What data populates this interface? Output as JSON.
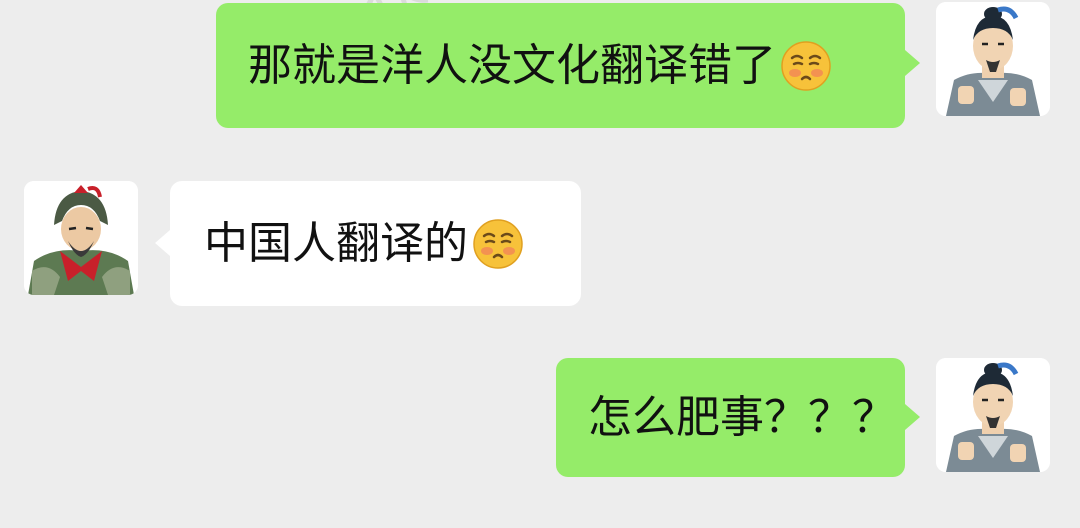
{
  "watermark": "公众号:",
  "messages": [
    {
      "side": "right",
      "text": "那就是洋人没文化翻译错了",
      "emoji": "flushed-pleading-face"
    },
    {
      "side": "left",
      "text": "中国人翻译的",
      "emoji": "flushed-pleading-face"
    },
    {
      "side": "right",
      "text": "怎么肥事？？？"
    }
  ],
  "colors": {
    "background": "#ededed",
    "self_bubble": "#95ec69",
    "other_bubble": "#ffffff"
  },
  "avatars": {
    "self": "scholar-avatar",
    "other": "general-avatar"
  }
}
